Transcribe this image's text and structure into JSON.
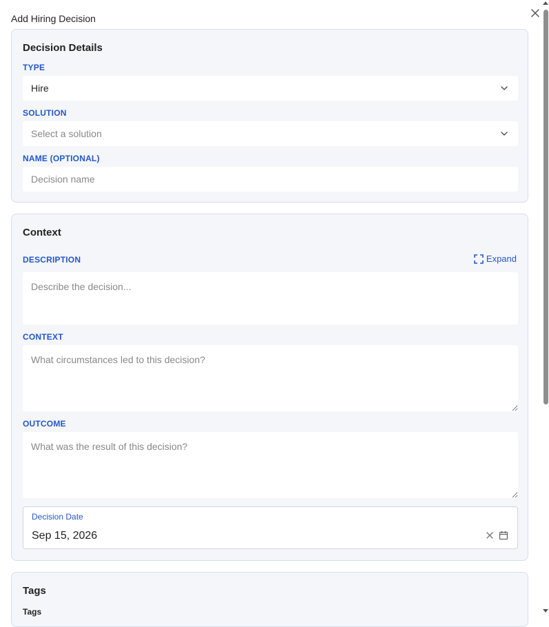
{
  "modal": {
    "title": "Add Hiring Decision"
  },
  "decision_details": {
    "title": "Decision Details",
    "type_label": "TYPE",
    "type_value": "Hire",
    "solution_label": "SOLUTION",
    "solution_placeholder": "Select a solution",
    "name_label": "NAME (OPTIONAL)",
    "name_placeholder": "Decision name"
  },
  "context_card": {
    "title": "Context",
    "description_label": "DESCRIPTION",
    "expand_label": "Expand",
    "description_placeholder": "Describe the decision...",
    "context_label": "CONTEXT",
    "context_placeholder": "What circumstances led to this decision?",
    "outcome_label": "OUTCOME",
    "outcome_placeholder": "What was the result of this decision?",
    "date_label": "Decision Date",
    "date_value": "Sep 15, 2026"
  },
  "tags_card": {
    "title": "Tags",
    "tags_label": "Tags"
  },
  "colors": {
    "accent": "#2457c5",
    "card_bg": "#f4f6f9",
    "card_border": "#d6dee9"
  }
}
